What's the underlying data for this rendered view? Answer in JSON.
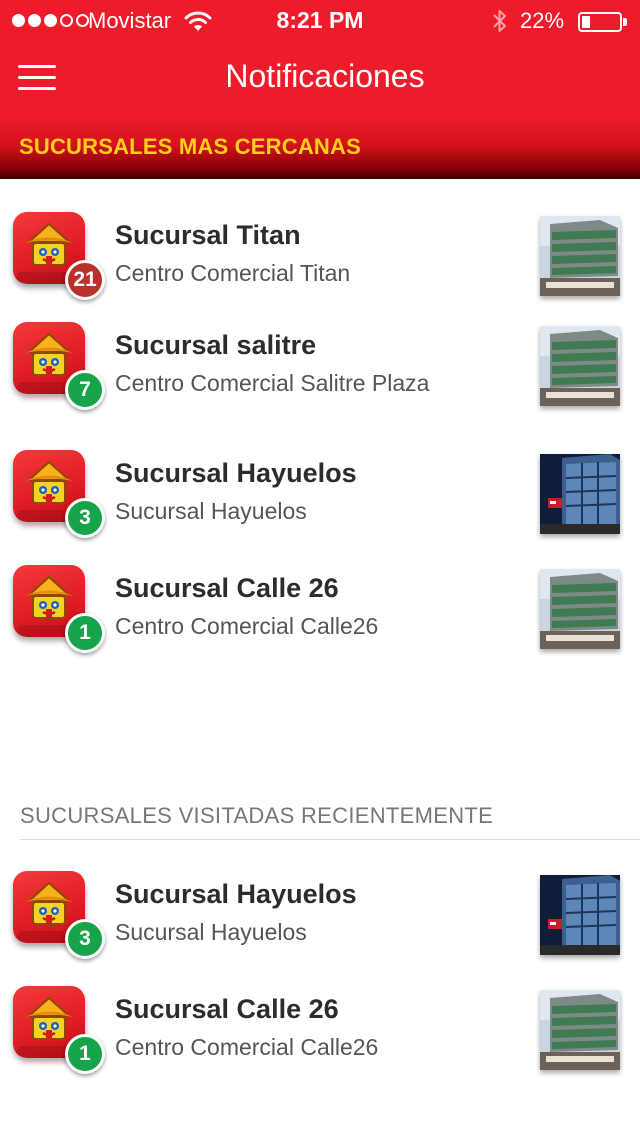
{
  "status_bar": {
    "carrier": "Movistar",
    "time": "8:21 PM",
    "battery": "22%",
    "battery_level": 0.22,
    "signal_bars_filled": 3,
    "signal_bars_total": 5
  },
  "nav": {
    "title": "Notificaciones",
    "menu_icon": "hamburger-menu-icon"
  },
  "colors": {
    "header_red": "#ee1c2a",
    "section_title_yellow": "#ffcf1a",
    "badge_green": "#16a34a",
    "badge_red": "#b7322d"
  },
  "nearby": {
    "title": "SUCURSALES MAS CERCANAS",
    "items": [
      {
        "title": "Sucursal Titan",
        "subtitle": "Centro Comercial Titan",
        "count": "21",
        "badge_color": "red",
        "thumb": "tower-building"
      },
      {
        "title": "Sucursal salitre",
        "subtitle": "Centro Comercial Salitre Plaza",
        "count": "7",
        "badge_color": "green",
        "thumb": "tower-building"
      },
      {
        "title": "Sucursal Hayuelos",
        "subtitle": "Sucursal Hayuelos",
        "count": "3",
        "badge_color": "green",
        "thumb": "glass-building-night"
      },
      {
        "title": "Sucursal Calle 26",
        "subtitle": "Centro Comercial Calle26",
        "count": "1",
        "badge_color": "green",
        "thumb": "tower-building"
      }
    ]
  },
  "recent": {
    "title": "SUCURSALES VISITADAS RECIENTEMENTE",
    "items": [
      {
        "title": "Sucursal Hayuelos",
        "subtitle": "Sucursal Hayuelos",
        "count": "3",
        "badge_color": "green",
        "thumb": "glass-building-night"
      },
      {
        "title": "Sucursal Calle 26",
        "subtitle": "Centro Comercial Calle26",
        "count": "1",
        "badge_color": "green",
        "thumb": "tower-building"
      }
    ]
  }
}
